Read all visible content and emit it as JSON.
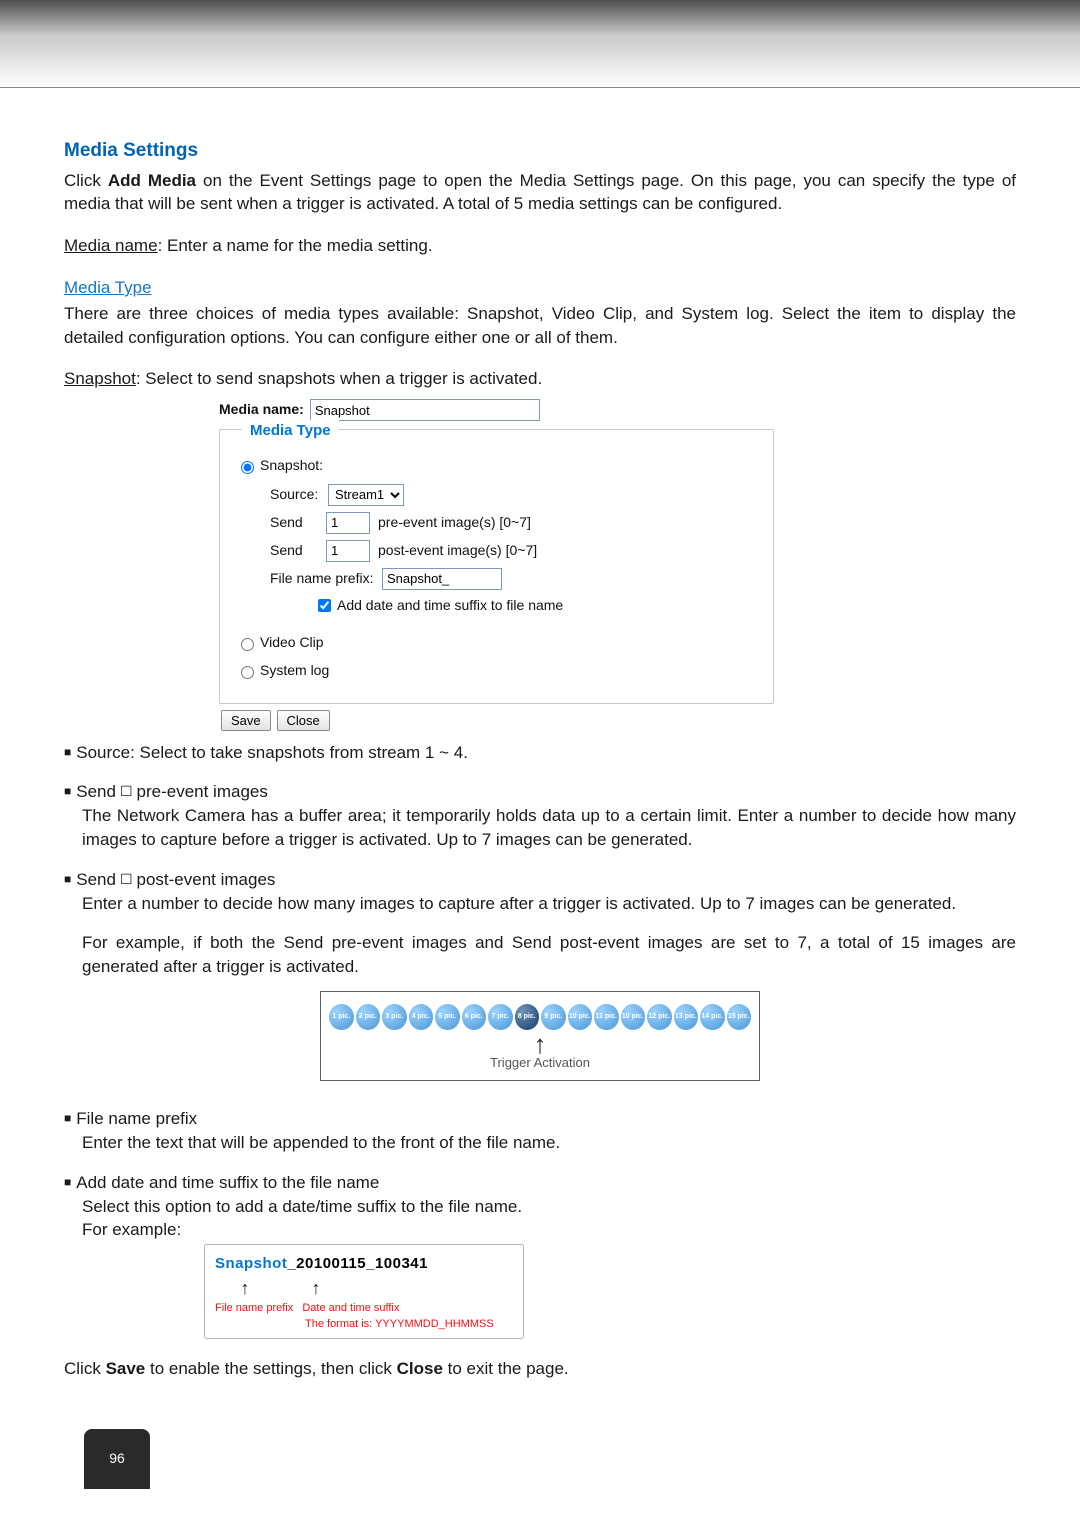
{
  "header": {
    "page_number": "96"
  },
  "section_title": "Media Settings",
  "intro": "Click Add Media on the Event Settings page to open the Media Settings page. On this page, you can specify the type of media that will be sent when a trigger is activated. A total of 5 media settings can be configured.",
  "media_name_label": "Media name",
  "media_name_desc": ": Enter a name for the media setting.",
  "media_type_link": "Media Type",
  "media_type_desc": "There are three choices of media types available: Snapshot, Video Clip, and System log. Select the item to display the detailed configuration options. You can configure either one or all of them.",
  "snapshot_heading_label": "Snapshot",
  "snapshot_heading_desc": ": Select to send snapshots when a trigger is activated.",
  "form": {
    "media_name_field_label": "Media name:",
    "media_name_value": "Snapshot",
    "fieldset_legend": "Media Type",
    "snapshot_radio": "Snapshot:",
    "source_label": "Source:",
    "source_value": "Stream1",
    "send_label": "Send",
    "pre_value": "1",
    "pre_suffix": "pre-event image(s) [0~7]",
    "post_value": "1",
    "post_suffix": "post-event image(s) [0~7]",
    "prefix_label": "File name prefix:",
    "prefix_value": "Snapshot_",
    "add_suffix_label": "Add date and time suffix to file name",
    "video_clip_radio": "Video Clip",
    "system_log_radio": "System log",
    "save_btn": "Save",
    "close_btn": "Close"
  },
  "bullets": {
    "source": "Source: Select to take snapshots from stream 1 ~ 4.",
    "pre_title": "Send ☐ pre-event images",
    "pre_body": "The Network Camera has a buffer area; it temporarily holds data up to a certain limit. Enter a number to decide how many images to capture before a trigger is activated. Up to 7 images can be generated.",
    "post_title": "Send ☐ post-event images",
    "post_body1": "Enter a number to decide how many images to capture after a trigger is activated. Up to 7 images can be generated.",
    "post_body2": "For example, if both the Send pre-event images and Send post-event images are set to 7, a total of 15 images are generated after a trigger is activated.",
    "prefix_title": "File name prefix",
    "prefix_body": "Enter the text that will be appended to the front of the file name.",
    "suffix_title": "Add date and time suffix to the file name",
    "suffix_body": "Select this option to add a date/time suffix to the file name.",
    "for_example": "For example:"
  },
  "trigger_diagram": {
    "pics": [
      "1 pic.",
      "2 pic.",
      "3 pic.",
      "4 pic.",
      "5 pic.",
      "6 pic.",
      "7 pic.",
      "8 pic.",
      "9 pic.",
      "10 pic.",
      "11 pic.",
      "10 pic.",
      "12 pic.",
      "13 pic.",
      "14 pic.",
      "15 pic."
    ],
    "highlight_index": 7,
    "caption": "Trigger Activation"
  },
  "filename_example": {
    "prefix": "Snapshot",
    "suffix": "_20100115_100341",
    "label_prefix": "File name prefix",
    "label_suffix": "Date and time suffix",
    "format": "The format is: YYYYMMDD_HHMMSS"
  },
  "closing": "Click Save to enable the settings, then click Close to exit the page."
}
